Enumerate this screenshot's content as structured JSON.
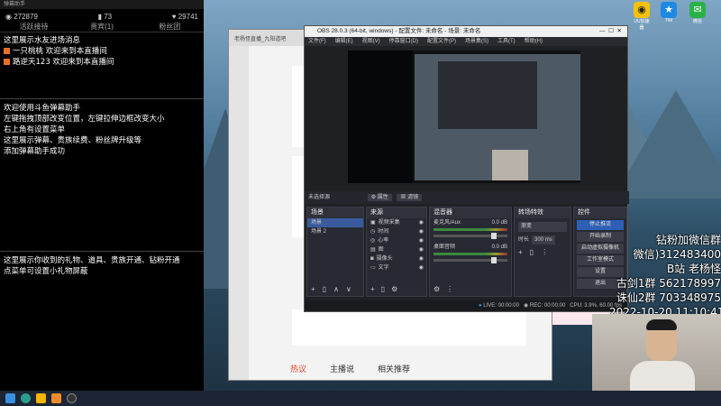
{
  "danmaku": {
    "window_title": "弹幕助手",
    "stats": {
      "viewers": "272879",
      "fans": "73",
      "likes": "29741"
    },
    "tabs": [
      "活跃接待",
      "贵宾(1)",
      "粉丝团"
    ],
    "lines_top": [
      {
        "text": "这里展示水友进场消息",
        "badge": false
      },
      {
        "text": "一只桃桃 欢迎来到本直播间",
        "badge": true
      },
      {
        "text": "路逆天123 欢迎来到本直播间",
        "badge": true
      }
    ],
    "lines_mid": [
      "欢迎使用斗鱼弹幕助手",
      "左键拖拽顶部改变位置，左键拉伸边框改变大小",
      "右上角有设置菜单",
      "这里展示弹幕、贵族续费、粉丝牌升级等",
      "添加弹幕助手成功"
    ],
    "lines_bottom": [
      "这里展示你收到的礼物、道具、贵族开通、钻粉开通",
      "点菜单可设置小礼物屏蔽"
    ]
  },
  "browser": {
    "tab_title": "老杨怪直播_九阳道吧",
    "bottom_tabs": [
      "热议",
      "主播说",
      "相关推荐"
    ]
  },
  "obs": {
    "title": "OBS 28.0.3 (64-bit, windows) - 配置文件: 未命名 - 场景: 未命名",
    "menu": [
      "文件(F)",
      "编辑(E)",
      "视图(V)",
      "停靠窗口(D)",
      "配置文件(P)",
      "场景集(S)",
      "工具(T)",
      "帮助(H)"
    ],
    "source_bar": {
      "label": "未选择源",
      "props": "属性",
      "filters": "滤镜"
    },
    "scenes": {
      "header": "场景",
      "items": [
        "场景",
        "场景 2"
      ]
    },
    "sources": {
      "header": "来源",
      "items": [
        "视频采集",
        "时间",
        "心率",
        "图",
        "摄像头",
        "文字"
      ]
    },
    "mixer": {
      "header": "混音器",
      "channels": [
        {
          "name": "麦克风/Aux",
          "db": "0.0 dB"
        },
        {
          "name": "桌面音频",
          "db": "0.0 dB"
        }
      ]
    },
    "transitions": {
      "header": "转场特效",
      "type": "渐变",
      "duration_label": "时长",
      "duration": "300 ms"
    },
    "controls": {
      "header": "控件",
      "buttons": [
        "停止推流",
        "开始录制",
        "启动虚拟摄像机",
        "工作室模式",
        "设置",
        "退出"
      ]
    },
    "status": {
      "live": "LIVE: 00:00:00",
      "rec": "REC: 00:00:00",
      "cpu": "CPU: 3.9%, 60.00 fps"
    }
  },
  "overlay": {
    "lines": [
      "钻粉加微信群",
      "微信)312483400",
      "B站 老杨怪",
      "古剑1群 562178997",
      "诛仙2群 703348975",
      "2022-10-20 11:10:41"
    ]
  },
  "desktop_icons": [
    {
      "label": "UU加速器",
      "icon": "owl-icon"
    },
    {
      "label": "TIM",
      "icon": "tim-icon"
    },
    {
      "label": "微信",
      "icon": "wechat-icon"
    }
  ]
}
